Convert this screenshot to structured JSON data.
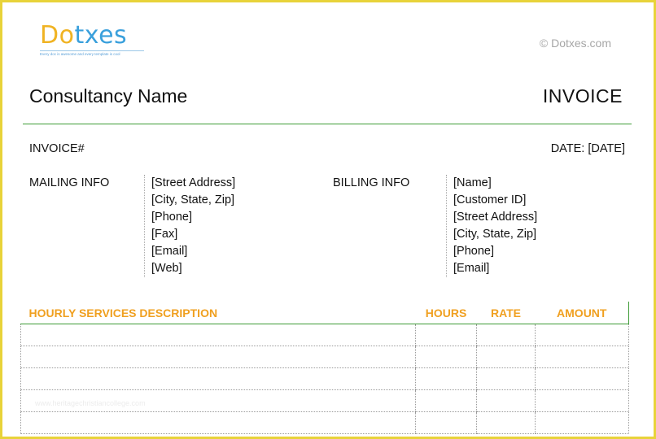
{
  "logo": {
    "letters": [
      "D",
      "o",
      "txes"
    ],
    "tagline": "Every doc is awesome and every template is cool"
  },
  "copyright": "© Dotxes.com",
  "header": {
    "company": "Consultancy Name",
    "title": "INVOICE"
  },
  "meta": {
    "invoice_label": "INVOICE#",
    "date_label": "DATE: [DATE]"
  },
  "mailing": {
    "label": "MAILING INFO",
    "lines": [
      "[Street Address]",
      "[City, State, Zip]",
      "[Phone]",
      "[Fax]",
      "[Email]",
      "[Web]"
    ]
  },
  "billing": {
    "label": "BILLING INFO",
    "lines": [
      "[Name]",
      "[Customer ID]",
      "[Street Address]",
      "[City, State, Zip]",
      "[Phone]",
      "[Email]"
    ]
  },
  "services_table": {
    "headers": [
      "HOURLY SERVICES DESCRIPTION",
      "HOURS",
      "RATE",
      "AMOUNT"
    ],
    "rows": [
      [
        "",
        "",
        "",
        ""
      ],
      [
        "",
        "",
        "",
        ""
      ],
      [
        "",
        "",
        "",
        ""
      ],
      [
        "",
        "",
        "",
        ""
      ],
      [
        "",
        "",
        "",
        ""
      ]
    ]
  },
  "watermark": "www.heritagechristiancollege.com",
  "colors": {
    "accent_green": "#3d9b35",
    "header_orange": "#f0a020",
    "logo_yellow": "#f0b323",
    "logo_blue": "#3aa0dc",
    "frame_yellow": "#e8d33a"
  }
}
